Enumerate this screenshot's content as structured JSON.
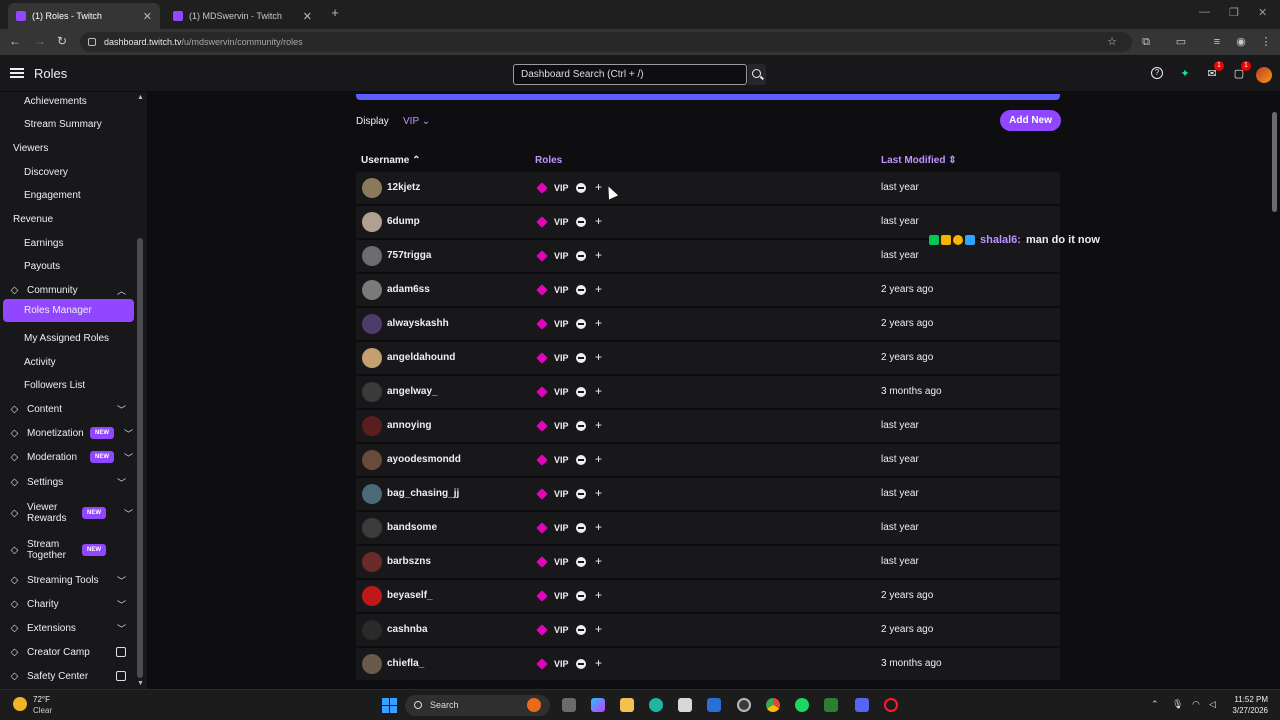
{
  "browser": {
    "tabs": [
      {
        "label": "(1) Roles - Twitch",
        "active": true
      },
      {
        "label": "(1) MDSwervin - Twitch",
        "active": false
      }
    ],
    "url_host": "dashboard.twitch.tv",
    "url_path": "/u/mdswervin/community/roles"
  },
  "topnav": {
    "title": "Roles",
    "search_placeholder": "Dashboard Search (Ctrl + /)",
    "notif_badge_1": "1",
    "notif_badge_2": "1"
  },
  "sidebar": {
    "items": [
      {
        "label": "Achievements",
        "kind": "child"
      },
      {
        "label": "Stream Summary",
        "kind": "child"
      },
      {
        "label": "Viewers",
        "kind": "head"
      },
      {
        "label": "Discovery",
        "kind": "child"
      },
      {
        "label": "Engagement",
        "kind": "child"
      },
      {
        "label": "Revenue",
        "kind": "head"
      },
      {
        "label": "Earnings",
        "kind": "child"
      },
      {
        "label": "Payouts",
        "kind": "child"
      },
      {
        "label": "Community",
        "kind": "cat",
        "icon": "community-icon",
        "expanded": true
      },
      {
        "label": "Roles Manager",
        "kind": "child",
        "active": true
      },
      {
        "label": "My Assigned Roles",
        "kind": "child"
      },
      {
        "label": "Activity",
        "kind": "child"
      },
      {
        "label": "Followers List",
        "kind": "child"
      },
      {
        "label": "Content",
        "kind": "cat",
        "icon": "content-icon"
      },
      {
        "label": "Monetization",
        "kind": "cat",
        "icon": "monetization-icon",
        "badge": "NEW"
      },
      {
        "label": "Moderation",
        "kind": "cat",
        "icon": "moderation-icon",
        "badge": "NEW"
      },
      {
        "label": "Settings",
        "kind": "cat",
        "icon": "settings-icon"
      },
      {
        "label": "Viewer",
        "label2": "Rewards",
        "kind": "cat",
        "icon": "viewer-rewards-icon",
        "badge": "NEW"
      },
      {
        "label": "Stream",
        "label2": "Together",
        "kind": "cat",
        "icon": "stream-together-icon",
        "badge": "NEW"
      },
      {
        "label": "Streaming Tools",
        "kind": "cat",
        "icon": "streaming-tools-icon"
      },
      {
        "label": "Charity",
        "kind": "cat",
        "icon": "charity-icon"
      },
      {
        "label": "Extensions",
        "kind": "cat",
        "icon": "extensions-icon"
      },
      {
        "label": "Creator Camp",
        "kind": "cat",
        "icon": "creator-camp-icon",
        "external": true
      },
      {
        "label": "Safety Center",
        "kind": "cat",
        "icon": "safety-center-icon",
        "external": true
      }
    ]
  },
  "main": {
    "display_label": "Display",
    "display_value": "VIP",
    "add_new_label": "Add New",
    "columns": {
      "username": "Username",
      "roles": "Roles",
      "last_modified": "Last Modified"
    },
    "rows": [
      {
        "username": "12kjetz",
        "role": "VIP",
        "last_modified": "last year"
      },
      {
        "username": "6dump",
        "role": "VIP",
        "last_modified": "last year"
      },
      {
        "username": "757trigga",
        "role": "VIP",
        "last_modified": "last year"
      },
      {
        "username": "adam6ss",
        "role": "VIP",
        "last_modified": "2 years ago"
      },
      {
        "username": "alwayskashh",
        "role": "VIP",
        "last_modified": "2 years ago"
      },
      {
        "username": "angeldahound",
        "role": "VIP",
        "last_modified": "2 years ago"
      },
      {
        "username": "angelway_",
        "role": "VIP",
        "last_modified": "3 months ago"
      },
      {
        "username": "annoying",
        "role": "VIP",
        "last_modified": "last year"
      },
      {
        "username": "ayoodesmondd",
        "role": "VIP",
        "last_modified": "last year"
      },
      {
        "username": "bag_chasing_jj",
        "role": "VIP",
        "last_modified": "last year"
      },
      {
        "username": "bandsome",
        "role": "VIP",
        "last_modified": "last year"
      },
      {
        "username": "barbszns",
        "role": "VIP",
        "last_modified": "last year"
      },
      {
        "username": "beyaself_",
        "role": "VIP",
        "last_modified": "2 years ago"
      },
      {
        "username": "cashnba",
        "role": "VIP",
        "last_modified": "2 years ago"
      },
      {
        "username": "chiefla_",
        "role": "VIP",
        "last_modified": "3 months ago"
      }
    ],
    "chat_overlay": {
      "name": "shalal6:",
      "message": "man do it now"
    }
  },
  "taskbar": {
    "weather_temp": "72°F",
    "weather_desc": "Clear",
    "search_label": "Search",
    "time": "11:52 PM",
    "date": "3/27/2026"
  },
  "colors": {
    "accent": "#9147ff",
    "vip_pink": "#e005b9",
    "link_purple": "#bf94ff",
    "row_bg": "#18181b",
    "page_bg": "#0e0e10"
  }
}
